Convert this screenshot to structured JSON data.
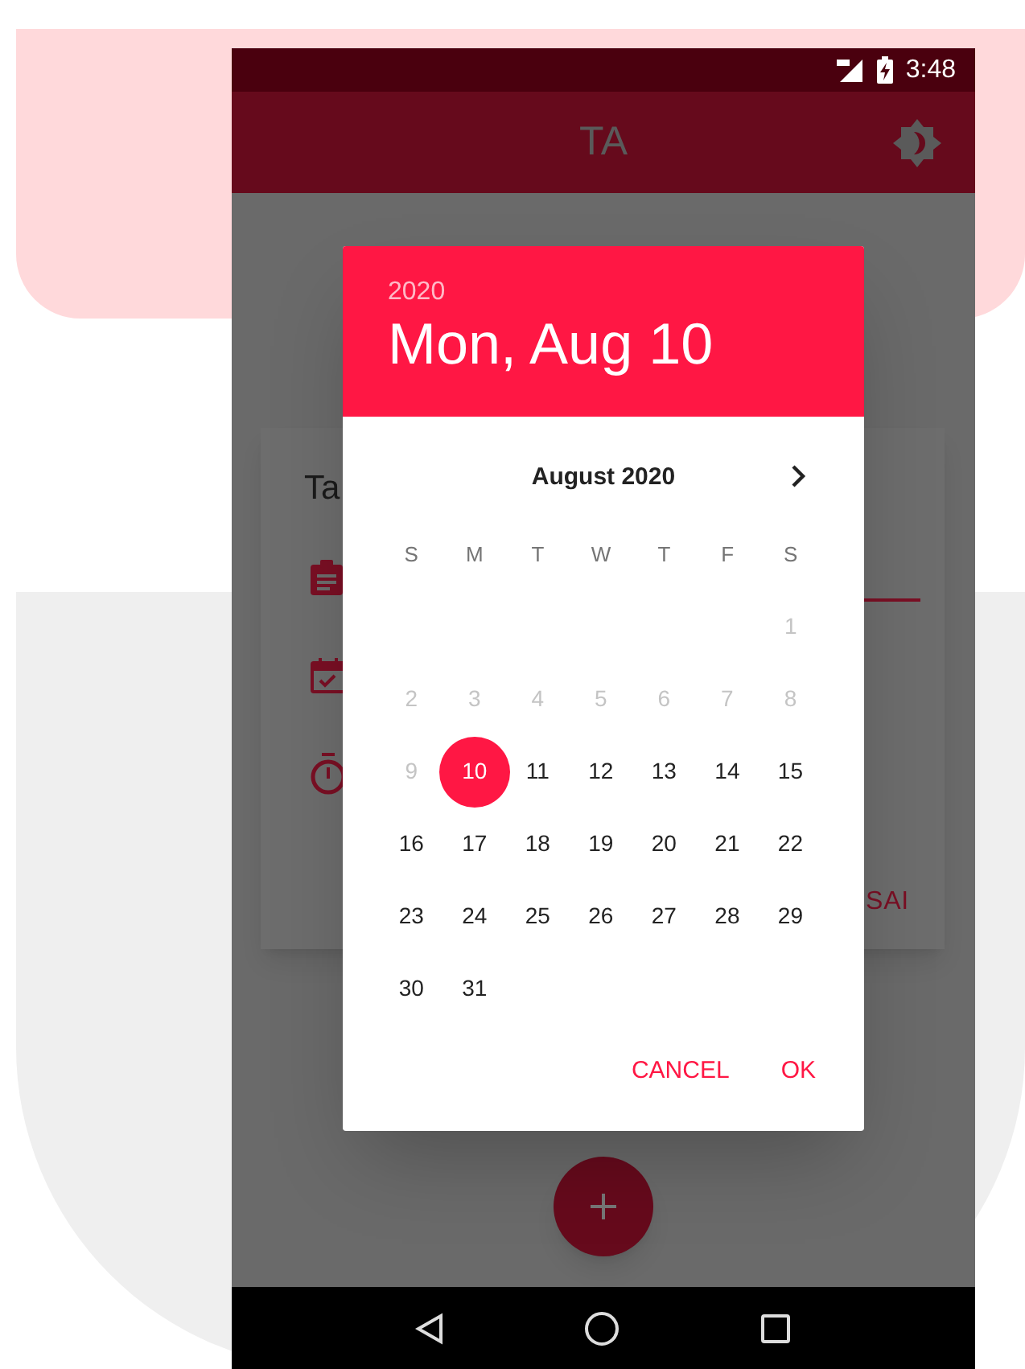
{
  "status_bar": {
    "time": "3:48"
  },
  "app_bar": {
    "title": "TA"
  },
  "background_card": {
    "title": "Ta",
    "action": "SAI"
  },
  "date_picker": {
    "year": "2020",
    "date": "Mon, Aug 10",
    "month": "August 2020",
    "weekdays": [
      "S",
      "M",
      "T",
      "W",
      "T",
      "F",
      "S"
    ],
    "weeks": [
      {
        "days": [
          {
            "day": "1",
            "disabled": true,
            "selected": false
          }
        ]
      },
      {
        "days": [
          {
            "day": "2",
            "disabled": true,
            "selected": false
          },
          {
            "day": "3",
            "disabled": true,
            "selected": false
          },
          {
            "day": "4",
            "disabled": true,
            "selected": false
          },
          {
            "day": "5",
            "disabled": true,
            "selected": false
          },
          {
            "day": "6",
            "disabled": true,
            "selected": false
          },
          {
            "day": "7",
            "disabled": true,
            "selected": false
          },
          {
            "day": "8",
            "disabled": true,
            "selected": false
          }
        ]
      },
      {
        "days": [
          {
            "day": "9",
            "disabled": true,
            "selected": false
          },
          {
            "day": "10",
            "disabled": false,
            "selected": true
          },
          {
            "day": "11",
            "disabled": false,
            "selected": false
          },
          {
            "day": "12",
            "disabled": false,
            "selected": false
          },
          {
            "day": "13",
            "disabled": false,
            "selected": false
          },
          {
            "day": "14",
            "disabled": false,
            "selected": false
          },
          {
            "day": "15",
            "disabled": false,
            "selected": false
          }
        ]
      },
      {
        "days": [
          {
            "day": "16",
            "disabled": false,
            "selected": false
          },
          {
            "day": "17",
            "disabled": false,
            "selected": false
          },
          {
            "day": "18",
            "disabled": false,
            "selected": false
          },
          {
            "day": "19",
            "disabled": false,
            "selected": false
          },
          {
            "day": "20",
            "disabled": false,
            "selected": false
          },
          {
            "day": "21",
            "disabled": false,
            "selected": false
          },
          {
            "day": "22",
            "disabled": false,
            "selected": false
          }
        ]
      },
      {
        "days": [
          {
            "day": "23",
            "disabled": false,
            "selected": false
          },
          {
            "day": "24",
            "disabled": false,
            "selected": false
          },
          {
            "day": "25",
            "disabled": false,
            "selected": false
          },
          {
            "day": "26",
            "disabled": false,
            "selected": false
          },
          {
            "day": "27",
            "disabled": false,
            "selected": false
          },
          {
            "day": "28",
            "disabled": false,
            "selected": false
          },
          {
            "day": "29",
            "disabled": false,
            "selected": false
          }
        ]
      },
      {
        "days": [
          {
            "day": "30",
            "disabled": false,
            "selected": false
          },
          {
            "day": "31",
            "disabled": false,
            "selected": false
          }
        ]
      }
    ],
    "buttons": [
      "CANCEL",
      "OK"
    ]
  }
}
